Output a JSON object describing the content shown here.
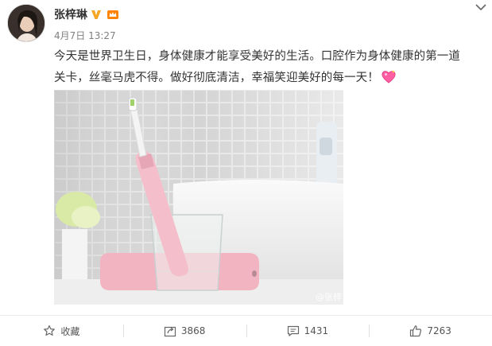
{
  "user": {
    "name": "张梓琳",
    "timestamp": "4月7日 13:27"
  },
  "post": {
    "line1": "今天是世界卫生日，身体健康才能享受美好的生活。口腔作为身体健康的第一道",
    "line2": "关卡，丝毫马虎不得。做好彻底清洁，幸福笑迎美好的每一天！",
    "image_watermark": "@张梓"
  },
  "actions": {
    "favorite_label": "收藏",
    "repost_count": "3868",
    "comment_count": "1431",
    "like_count": "7263"
  },
  "icons": {
    "verified": "verified-v-badge-icon",
    "member": "crown-member-icon",
    "more": "chevron-down-icon",
    "favorite": "star-icon",
    "repost": "repost-icon",
    "comment": "comment-icon",
    "like": "thumbs-up-icon",
    "emoji": "sparkling-heart-icon"
  },
  "colors": {
    "text": "#333333",
    "meta": "#808080",
    "verified": "#f5a623",
    "member": "#ff8200"
  }
}
